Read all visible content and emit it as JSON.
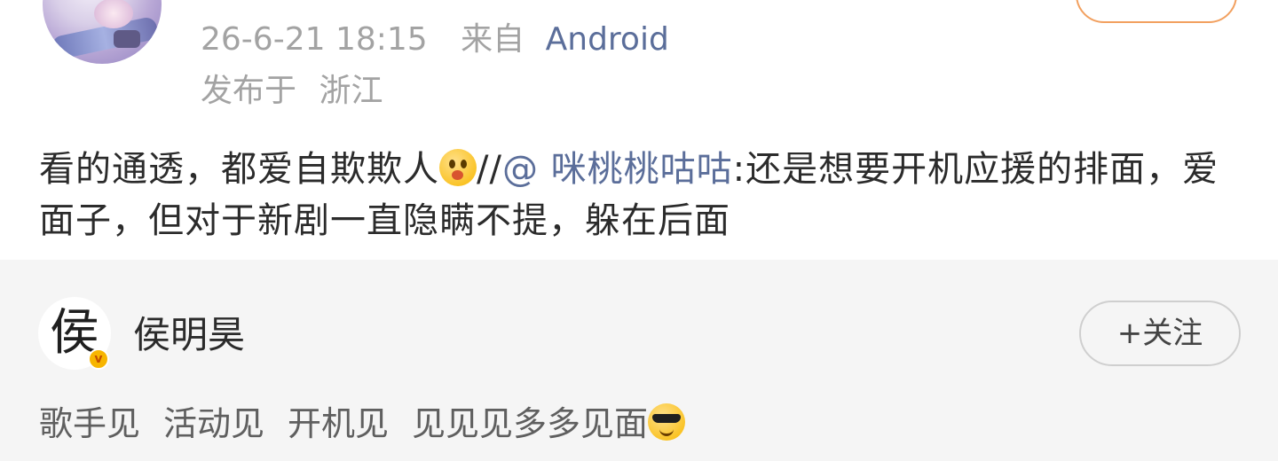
{
  "post": {
    "timestamp": "26-6-21 18:15",
    "source_label": "来自",
    "source_device": "Android",
    "location_label": "发布于",
    "location_value": "浙江",
    "text_part1": "看的通透，都爱自欺欺人",
    "emoji1": "peeking-face-emoji",
    "repost_prefix": "//",
    "mention": "@ 咪桃桃咕咕",
    "text_part2": ":还是想要开机应援的排面，爱面子，但对于新剧一直隐瞒不提，躲在后面"
  },
  "card": {
    "avatar_glyph": "侯",
    "verified_badge": "v",
    "name": "侯明昊",
    "follow_label": "+关注",
    "bio_items": [
      "歌手见",
      "活动见",
      "开机见",
      "见见见多多见面"
    ],
    "emoji2": "sunglasses-face-emoji"
  },
  "colors": {
    "link": "#5b6e9a",
    "meta": "#a3a3a3",
    "card_bg": "#f5f5f5",
    "badge": "#f7b500",
    "top_follow_border": "#f2a05f"
  }
}
